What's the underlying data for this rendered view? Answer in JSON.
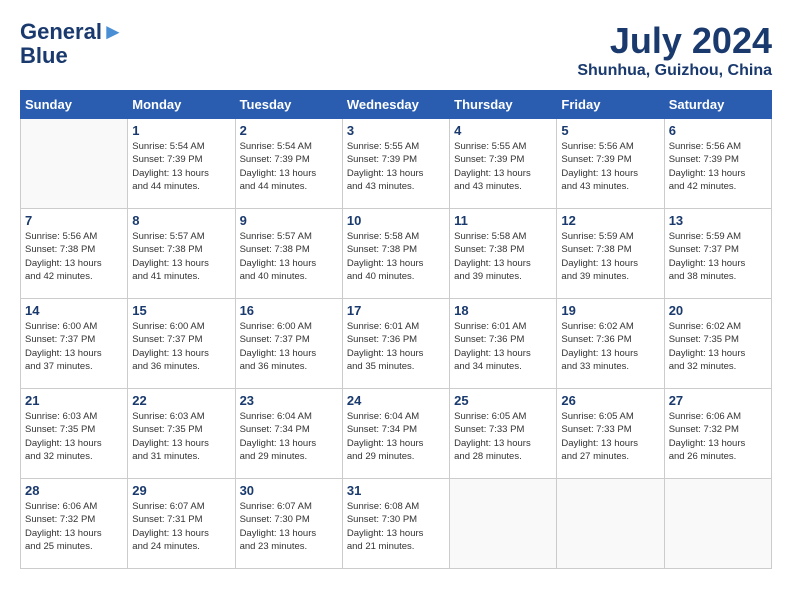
{
  "header": {
    "logo_line1": "General",
    "logo_line2": "Blue",
    "month_title": "July 2024",
    "subtitle": "Shunhua, Guizhou, China"
  },
  "weekdays": [
    "Sunday",
    "Monday",
    "Tuesday",
    "Wednesday",
    "Thursday",
    "Friday",
    "Saturday"
  ],
  "weeks": [
    [
      {
        "day": "",
        "info": ""
      },
      {
        "day": "1",
        "info": "Sunrise: 5:54 AM\nSunset: 7:39 PM\nDaylight: 13 hours\nand 44 minutes."
      },
      {
        "day": "2",
        "info": "Sunrise: 5:54 AM\nSunset: 7:39 PM\nDaylight: 13 hours\nand 44 minutes."
      },
      {
        "day": "3",
        "info": "Sunrise: 5:55 AM\nSunset: 7:39 PM\nDaylight: 13 hours\nand 43 minutes."
      },
      {
        "day": "4",
        "info": "Sunrise: 5:55 AM\nSunset: 7:39 PM\nDaylight: 13 hours\nand 43 minutes."
      },
      {
        "day": "5",
        "info": "Sunrise: 5:56 AM\nSunset: 7:39 PM\nDaylight: 13 hours\nand 43 minutes."
      },
      {
        "day": "6",
        "info": "Sunrise: 5:56 AM\nSunset: 7:39 PM\nDaylight: 13 hours\nand 42 minutes."
      }
    ],
    [
      {
        "day": "7",
        "info": "Sunrise: 5:56 AM\nSunset: 7:38 PM\nDaylight: 13 hours\nand 42 minutes."
      },
      {
        "day": "8",
        "info": "Sunrise: 5:57 AM\nSunset: 7:38 PM\nDaylight: 13 hours\nand 41 minutes."
      },
      {
        "day": "9",
        "info": "Sunrise: 5:57 AM\nSunset: 7:38 PM\nDaylight: 13 hours\nand 40 minutes."
      },
      {
        "day": "10",
        "info": "Sunrise: 5:58 AM\nSunset: 7:38 PM\nDaylight: 13 hours\nand 40 minutes."
      },
      {
        "day": "11",
        "info": "Sunrise: 5:58 AM\nSunset: 7:38 PM\nDaylight: 13 hours\nand 39 minutes."
      },
      {
        "day": "12",
        "info": "Sunrise: 5:59 AM\nSunset: 7:38 PM\nDaylight: 13 hours\nand 39 minutes."
      },
      {
        "day": "13",
        "info": "Sunrise: 5:59 AM\nSunset: 7:37 PM\nDaylight: 13 hours\nand 38 minutes."
      }
    ],
    [
      {
        "day": "14",
        "info": "Sunrise: 6:00 AM\nSunset: 7:37 PM\nDaylight: 13 hours\nand 37 minutes."
      },
      {
        "day": "15",
        "info": "Sunrise: 6:00 AM\nSunset: 7:37 PM\nDaylight: 13 hours\nand 36 minutes."
      },
      {
        "day": "16",
        "info": "Sunrise: 6:00 AM\nSunset: 7:37 PM\nDaylight: 13 hours\nand 36 minutes."
      },
      {
        "day": "17",
        "info": "Sunrise: 6:01 AM\nSunset: 7:36 PM\nDaylight: 13 hours\nand 35 minutes."
      },
      {
        "day": "18",
        "info": "Sunrise: 6:01 AM\nSunset: 7:36 PM\nDaylight: 13 hours\nand 34 minutes."
      },
      {
        "day": "19",
        "info": "Sunrise: 6:02 AM\nSunset: 7:36 PM\nDaylight: 13 hours\nand 33 minutes."
      },
      {
        "day": "20",
        "info": "Sunrise: 6:02 AM\nSunset: 7:35 PM\nDaylight: 13 hours\nand 32 minutes."
      }
    ],
    [
      {
        "day": "21",
        "info": "Sunrise: 6:03 AM\nSunset: 7:35 PM\nDaylight: 13 hours\nand 32 minutes."
      },
      {
        "day": "22",
        "info": "Sunrise: 6:03 AM\nSunset: 7:35 PM\nDaylight: 13 hours\nand 31 minutes."
      },
      {
        "day": "23",
        "info": "Sunrise: 6:04 AM\nSunset: 7:34 PM\nDaylight: 13 hours\nand 29 minutes."
      },
      {
        "day": "24",
        "info": "Sunrise: 6:04 AM\nSunset: 7:34 PM\nDaylight: 13 hours\nand 29 minutes."
      },
      {
        "day": "25",
        "info": "Sunrise: 6:05 AM\nSunset: 7:33 PM\nDaylight: 13 hours\nand 28 minutes."
      },
      {
        "day": "26",
        "info": "Sunrise: 6:05 AM\nSunset: 7:33 PM\nDaylight: 13 hours\nand 27 minutes."
      },
      {
        "day": "27",
        "info": "Sunrise: 6:06 AM\nSunset: 7:32 PM\nDaylight: 13 hours\nand 26 minutes."
      }
    ],
    [
      {
        "day": "28",
        "info": "Sunrise: 6:06 AM\nSunset: 7:32 PM\nDaylight: 13 hours\nand 25 minutes."
      },
      {
        "day": "29",
        "info": "Sunrise: 6:07 AM\nSunset: 7:31 PM\nDaylight: 13 hours\nand 24 minutes."
      },
      {
        "day": "30",
        "info": "Sunrise: 6:07 AM\nSunset: 7:30 PM\nDaylight: 13 hours\nand 23 minutes."
      },
      {
        "day": "31",
        "info": "Sunrise: 6:08 AM\nSunset: 7:30 PM\nDaylight: 13 hours\nand 21 minutes."
      },
      {
        "day": "",
        "info": ""
      },
      {
        "day": "",
        "info": ""
      },
      {
        "day": "",
        "info": ""
      }
    ]
  ]
}
